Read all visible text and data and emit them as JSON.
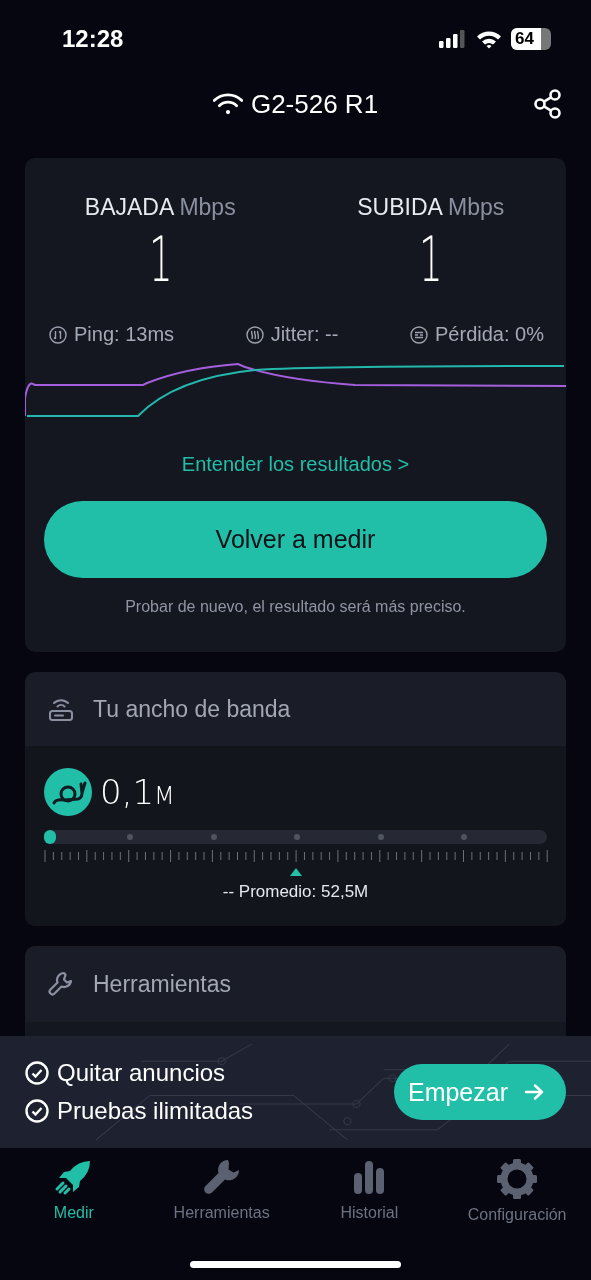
{
  "status_bar": {
    "time": "12:28",
    "battery": "64"
  },
  "header": {
    "network": "G2-526 R1"
  },
  "results": {
    "speeds": [
      {
        "label": "BAJADA",
        "unit": "Mbps",
        "value": "1"
      },
      {
        "label": "SUBIDA",
        "unit": "Mbps",
        "value": "1"
      }
    ],
    "stats": [
      {
        "kind": "ping",
        "text": "Ping: 13ms"
      },
      {
        "kind": "jitter",
        "text": "Jitter: --"
      },
      {
        "kind": "loss",
        "text": "Pérdida: 0%"
      }
    ],
    "link": "Entender los resultados >",
    "button": "Volver a medir",
    "hint": "Probar de nuevo, el resultado será más preciso."
  },
  "bandwidth": {
    "title": "Tu ancho de banda",
    "value": "0,1",
    "unit": "M",
    "level": 0,
    "average": "-- Promedio: 52,5M"
  },
  "tools": {
    "title": "Herramientas"
  },
  "promo": {
    "features": [
      "Quitar anuncios",
      "Pruebas ilimitadas"
    ],
    "button": "Empezar"
  },
  "tabs": [
    {
      "label": "Medir",
      "kind": "rocket",
      "selected": true
    },
    {
      "label": "Herramientas",
      "kind": "wrench",
      "selected": false
    },
    {
      "label": "Historial",
      "kind": "bars",
      "selected": false
    },
    {
      "label": "Configuración",
      "kind": "gear",
      "selected": false
    }
  ]
}
